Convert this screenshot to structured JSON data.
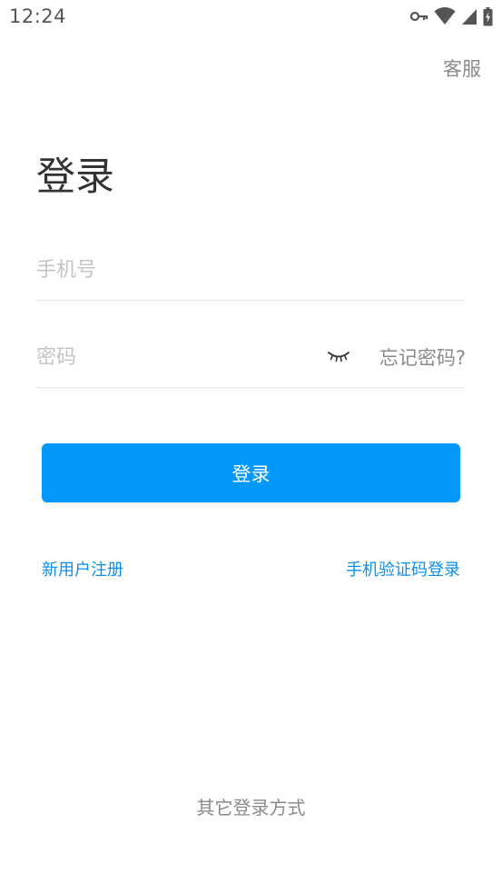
{
  "status_bar": {
    "time": "12:24",
    "icons": [
      "vpn-key-icon",
      "wifi-icon",
      "cell-signal-icon",
      "battery-charging-icon"
    ]
  },
  "header": {
    "service_label": "客服"
  },
  "page": {
    "title": "登录"
  },
  "form": {
    "phone": {
      "placeholder": "手机号",
      "value": ""
    },
    "password": {
      "placeholder": "密码",
      "value": "",
      "toggle_icon": "eye-closed-icon",
      "forgot_label": "忘记密码?"
    },
    "submit_label": "登录"
  },
  "links": {
    "register_label": "新用户注册",
    "sms_login_label": "手机验证码登录"
  },
  "footer": {
    "other_login_label": "其它登录方式"
  },
  "colors": {
    "primary": "#0598fb",
    "link": "#0a8ff0",
    "muted_text": "#8a8a8a",
    "placeholder": "#c4c4c4",
    "title": "#333333"
  }
}
